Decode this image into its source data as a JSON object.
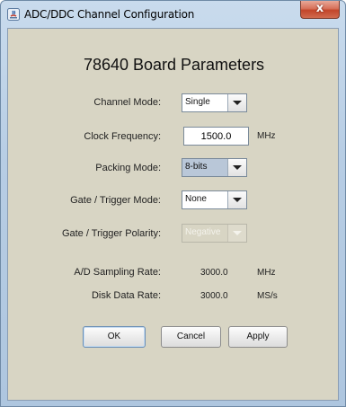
{
  "window": {
    "title": "ADC/DDC Channel Configuration",
    "close_label": "x"
  },
  "dialog": {
    "heading": "78640 Board Parameters",
    "channel_mode": {
      "label": "Channel Mode:",
      "value": "Single"
    },
    "clock_frequency": {
      "label": "Clock Frequency:",
      "value": "1500.0",
      "unit": "MHz"
    },
    "packing_mode": {
      "label": "Packing Mode:",
      "value": "8-bits"
    },
    "gate_trigger_mode": {
      "label": "Gate / Trigger Mode:",
      "value": "None"
    },
    "gate_trigger_polarity": {
      "label": "Gate / Trigger Polarity:",
      "value": "Negative"
    },
    "ad_sampling_rate": {
      "label": "A/D Sampling Rate:",
      "value": "3000.0",
      "unit": "MHz"
    },
    "disk_data_rate": {
      "label": "Disk Data Rate:",
      "value": "3000.0",
      "unit": "MS/s"
    },
    "buttons": {
      "ok": "OK",
      "cancel": "Cancel",
      "apply": "Apply"
    }
  },
  "colors": {
    "panel": "#d8d5c4",
    "close": "#c2452a",
    "selected_combo": "#b9c7d8"
  },
  "icons": {
    "title_icon": "java-app-icon",
    "combo_arrow": "chevron-down-icon"
  }
}
